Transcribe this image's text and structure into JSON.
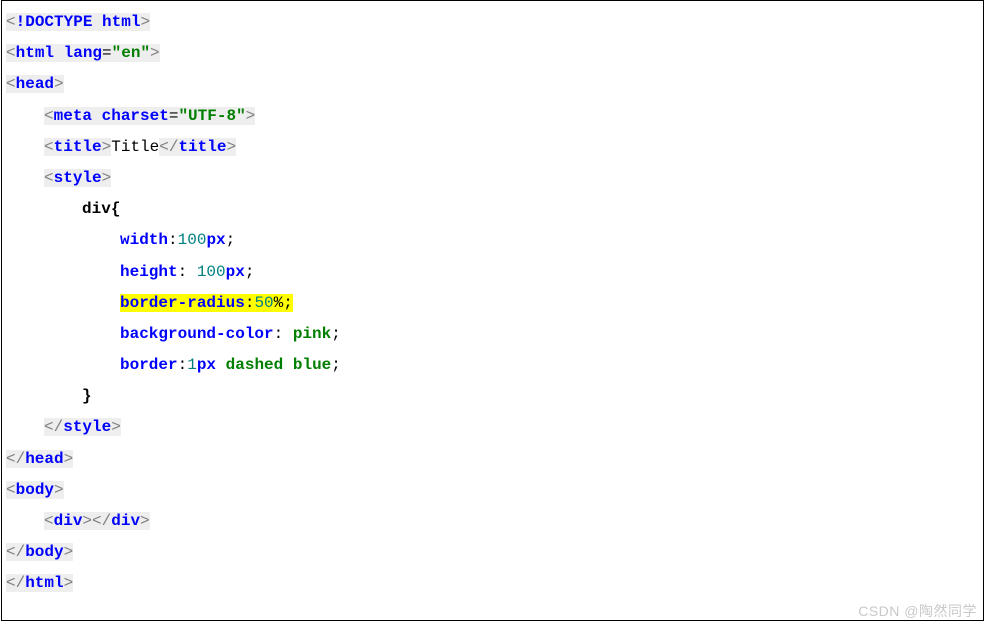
{
  "watermark": "CSDN @陶然同学",
  "code": {
    "l1": {
      "name": "!DOCTYPE ",
      "doctype_kw": "html"
    },
    "l2": {
      "tag": "html",
      "attr": "lang",
      "val": "\"en\""
    },
    "l3": {
      "tag": "head"
    },
    "l4": {
      "tag": "meta",
      "attr": "charset",
      "val": "\"UTF-8\""
    },
    "l5": {
      "open": "title",
      "text": "Title",
      "close": "title"
    },
    "l6": {
      "tag": "style"
    },
    "l7": {
      "selector": "div",
      "brace": "{"
    },
    "l8": {
      "prop": "width",
      "num": "100",
      "unit": "px",
      "semi": ";"
    },
    "l9": {
      "prop": "height",
      "num": "100",
      "unit": "px",
      "semi": ";"
    },
    "l10": {
      "prop": "border-radius",
      "num": "50",
      "pct": "%",
      "semi": ";"
    },
    "l11": {
      "prop": "background-color",
      "val": "pink",
      "semi": ";"
    },
    "l12": {
      "prop": "border",
      "num": "1",
      "unit": "px",
      "kw1": "dashed",
      "kw2": "blue",
      "semi": ";"
    },
    "l13": {
      "brace": "}"
    },
    "l14": {
      "close": "style"
    },
    "l15": {
      "close": "head"
    },
    "l16": {
      "tag": "body"
    },
    "l17": {
      "open": "div",
      "close": "div"
    },
    "l18": {
      "close": "body"
    },
    "l19": {
      "close": "html"
    }
  }
}
